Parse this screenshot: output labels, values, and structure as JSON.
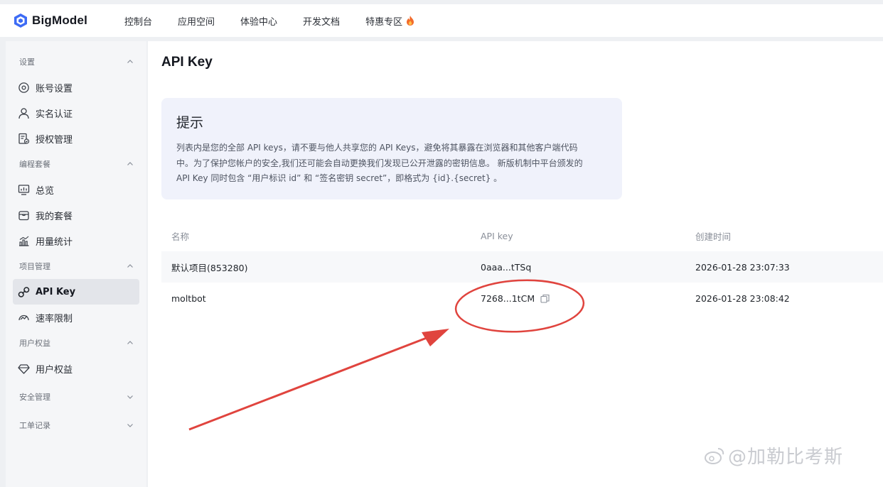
{
  "brand": {
    "name": "BigModel"
  },
  "topnav": {
    "items": [
      {
        "label": "控制台"
      },
      {
        "label": "应用空间"
      },
      {
        "label": "体验中心"
      },
      {
        "label": "开发文档"
      },
      {
        "label": "特惠专区"
      }
    ]
  },
  "sidebar": {
    "groups": [
      {
        "label": "设置",
        "items": [
          {
            "label": "账号设置",
            "icon": "gear-icon"
          },
          {
            "label": "实名认证",
            "icon": "user-icon"
          },
          {
            "label": "授权管理",
            "icon": "document-check-icon"
          }
        ]
      },
      {
        "label": "编程套餐",
        "items": [
          {
            "label": "总览",
            "icon": "monitor-chart-icon"
          },
          {
            "label": "我的套餐",
            "icon": "package-icon"
          },
          {
            "label": "用量统计",
            "icon": "bar-chart-icon"
          }
        ]
      },
      {
        "label": "项目管理",
        "items": [
          {
            "label": "API Key",
            "icon": "key-link-icon",
            "active": true
          },
          {
            "label": "速率限制",
            "icon": "speed-gauge-icon"
          }
        ]
      },
      {
        "label": "用户权益",
        "items": [
          {
            "label": "用户权益",
            "icon": "diamond-icon"
          }
        ]
      },
      {
        "label": "安全管理",
        "items": []
      },
      {
        "label": "工单记录",
        "items": []
      }
    ]
  },
  "page": {
    "title": "API Key"
  },
  "tip": {
    "title": "提示",
    "lines": [
      "列表内是您的全部 API keys，请不要与他人共享您的 API Keys，避免将其暴露在浏览器和其他客户端代码",
      "中。为了保护您帐户的安全,我们还可能会自动更换我们发现已公开泄露的密钥信息。 新版机制中平台颁发的",
      "API Key 同时包含 “用户标识 id” 和 “签名密钥 secret”，即格式为 {id}.{secret} 。"
    ]
  },
  "table": {
    "headers": [
      "名称",
      "API key",
      "创建时间"
    ],
    "rows": [
      {
        "name": "默认项目(853280)",
        "key": "0aaa...tTSq",
        "created": "2026-01-28 23:07:33"
      },
      {
        "name": "moltbot",
        "key": "7268...1tCM",
        "created": "2026-01-28 23:08:42"
      }
    ]
  },
  "annotation": {
    "color": "#e0443e"
  },
  "watermark": {
    "text": "@加勒比考斯"
  }
}
